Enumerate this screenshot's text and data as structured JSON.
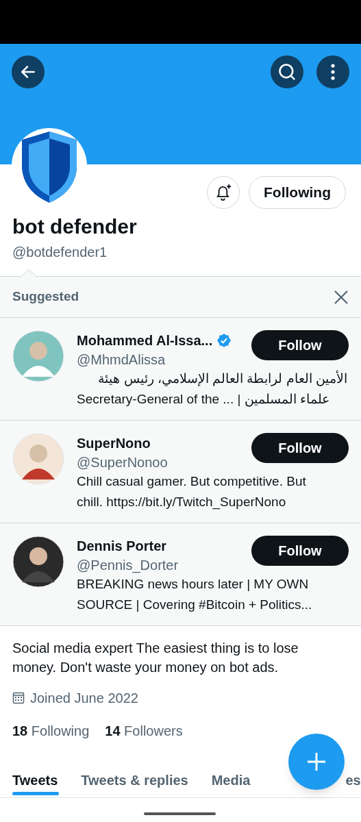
{
  "profile": {
    "name": "bot defender",
    "handle": "@botdefender1",
    "following_button": "Following",
    "bio": "Social media expert The easiest thing is to lose money. Don't waste your money on bot ads.",
    "joined": "Joined June 2022",
    "stats": [
      {
        "count": "18",
        "label": "Following"
      },
      {
        "count": "14",
        "label": "Followers"
      }
    ]
  },
  "suggested": {
    "title": "Suggested",
    "users": [
      {
        "name": "Mohammed Al-Issa...",
        "verified": true,
        "handle": "@MhmdAlissa",
        "bio_lines": [
          {
            "text": "الأمين العام لرابطة العالم الإسلامي، رئيس هيئة",
            "rtl": true
          },
          {
            "text": "Secretary-General of the ... | علماء المسلمين",
            "rtl": false
          }
        ],
        "button": "Follow"
      },
      {
        "name": "SuperNono",
        "verified": false,
        "handle": "@SuperNonoo",
        "bio_lines": [
          {
            "text": "Chill casual gamer. But competitive. But",
            "rtl": false
          },
          {
            "text": "chill.  https://bit.ly/Twitch_SuperNono",
            "rtl": false
          }
        ],
        "button": "Follow"
      },
      {
        "name": "Dennis Porter",
        "verified": false,
        "handle": "@Pennis_Dorter",
        "bio_lines": [
          {
            "text": "BREAKING news hours later | MY OWN",
            "rtl": false
          },
          {
            "text": "SOURCE | Covering #Bitcoin + Politics...",
            "rtl": false
          }
        ],
        "button": "Follow"
      }
    ]
  },
  "tabs": [
    {
      "label": "Tweets",
      "selected": true
    },
    {
      "label": "Tweets & replies",
      "selected": false
    },
    {
      "label": "Media",
      "selected": false
    },
    {
      "label": "es",
      "selected": false
    }
  ]
}
